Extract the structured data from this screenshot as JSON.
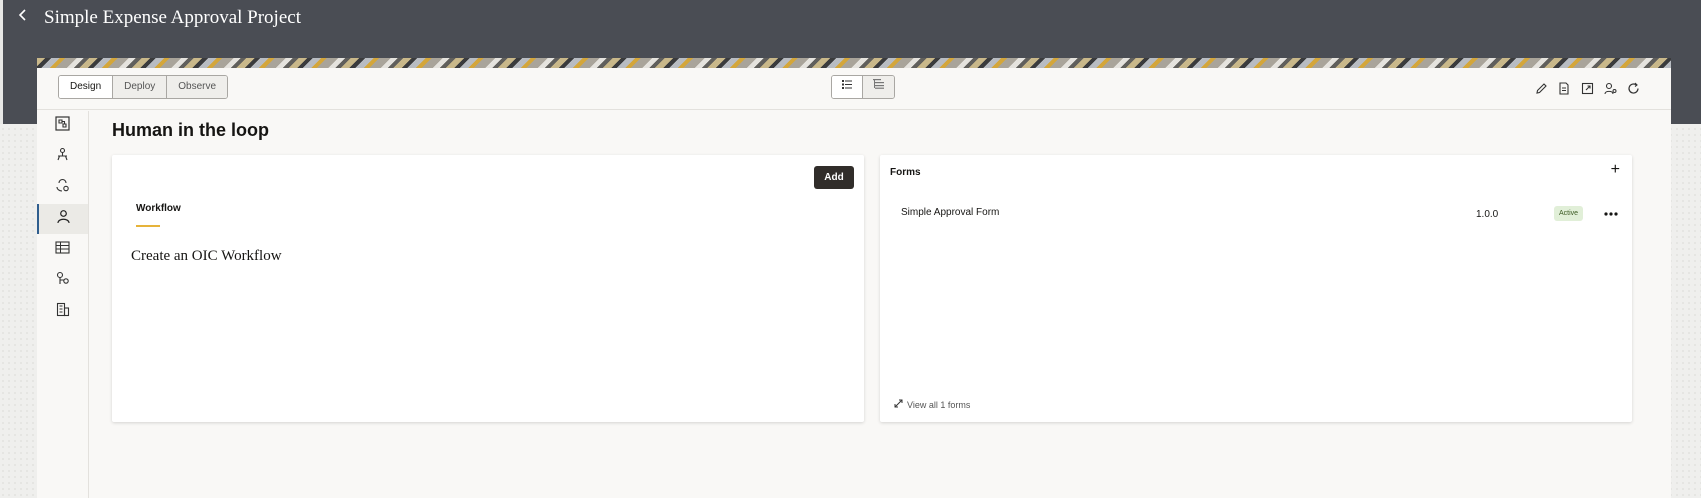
{
  "app": {
    "title": "Simple Expense Approval Project"
  },
  "toolbar": {
    "modes": [
      "Design",
      "Deploy",
      "Observe"
    ],
    "active_mode": "Design",
    "view_toggles": [
      "list-view-icon",
      "tree-view-icon"
    ],
    "actions": [
      "pencil-icon",
      "document-icon",
      "export-icon",
      "user-settings-icon",
      "refresh-icon"
    ]
  },
  "sidenav": {
    "items": [
      {
        "icon": "integrations-icon"
      },
      {
        "icon": "connections-icon"
      },
      {
        "icon": "lookups-icon"
      },
      {
        "icon": "human-in-the-loop-icon"
      },
      {
        "icon": "table-icon"
      },
      {
        "icon": "libraries-icon"
      },
      {
        "icon": "building-icon"
      }
    ],
    "active_index": 3
  },
  "page": {
    "title": "Human in the loop"
  },
  "workflow_card": {
    "add_label": "Add",
    "tab_label": "Workflow",
    "empty_text": "Create an OIC Workflow"
  },
  "forms_card": {
    "title": "Forms",
    "plus_label": "+",
    "forms": [
      {
        "name": "Simple Approval Form",
        "version": "1.0.0",
        "status": "Active"
      }
    ],
    "view_all_label": "View all 1 forms"
  },
  "colors": {
    "topbar": "#4a4d54",
    "accent_tab": "#e6b33a",
    "active_badge_bg": "#e1efd8",
    "add_button_bg": "#312d2a"
  }
}
